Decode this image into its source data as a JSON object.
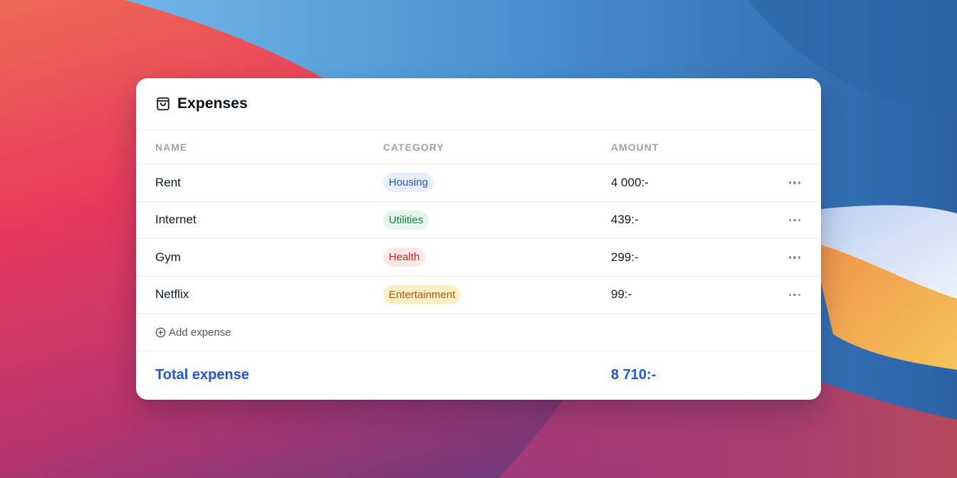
{
  "card": {
    "title": "Expenses",
    "title_icon": "shopping-bag-icon"
  },
  "table": {
    "headers": {
      "name": "NAME",
      "category": "CATEGORY",
      "amount": "AMOUNT"
    },
    "rows": [
      {
        "name": "Rent",
        "category": "Housing",
        "amount": "4 000:-"
      },
      {
        "name": "Internet",
        "category": "Utilities",
        "amount": "439:-"
      },
      {
        "name": "Gym",
        "category": "Health",
        "amount": "299:-"
      },
      {
        "name": "Netflix",
        "category": "Entertainment",
        "amount": "99:-"
      }
    ],
    "row_action_icon": "more-horizontal-icon"
  },
  "category_colors": {
    "Housing": {
      "bg": "#e8efff",
      "fg": "#2b55c4"
    },
    "Utilities": {
      "bg": "#e4f6ea",
      "fg": "#1b7a3e"
    },
    "Health": {
      "bg": "#fde8e8",
      "fg": "#c62828"
    },
    "Entertainment": {
      "bg": "#fdefc5",
      "fg": "#b35a10"
    }
  },
  "add_expense": {
    "label": "Add expense",
    "icon": "plus-circle-icon"
  },
  "total": {
    "label": "Total expense",
    "value": "8 710:-",
    "color": "#2456d3"
  }
}
